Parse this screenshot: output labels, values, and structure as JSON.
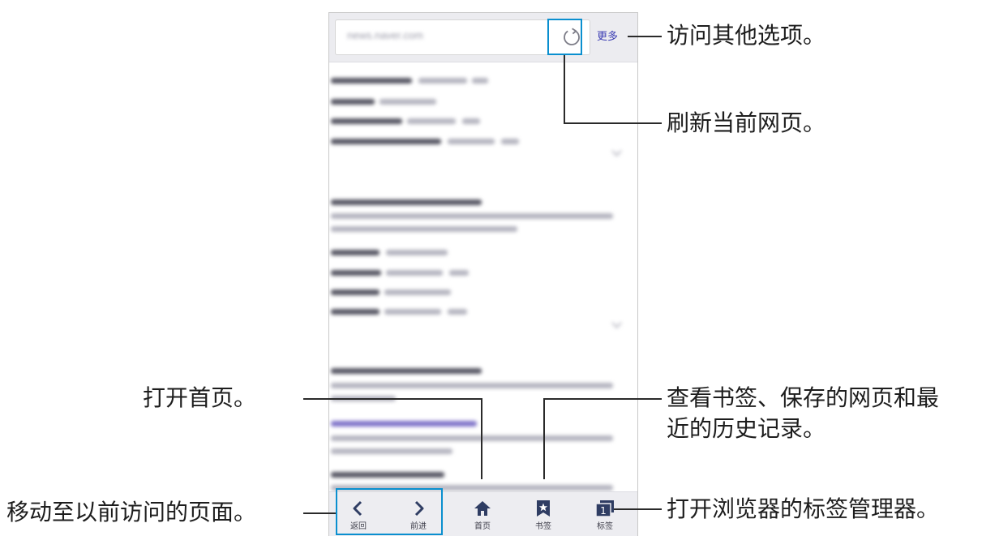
{
  "browser": {
    "url": "news.naver.com",
    "more_label": "更多"
  },
  "nav": {
    "back_label": "返回",
    "forward_label": "前进",
    "home_label": "首页",
    "bookmarks_label": "书签",
    "tabs_label": "标签",
    "tab_count": "1"
  },
  "callouts": {
    "more": "访问其他选项。",
    "refresh": "刷新当前网页。",
    "home": "打开首页。",
    "bookmarks_line1": "查看书签、保存的网页和最",
    "bookmarks_line2": "近的历史记录。",
    "back_forward": "移动至以前访问的页面。",
    "tabs": "打开浏览器的标签管理器。"
  },
  "colors": {
    "highlight": "#0a8fcf",
    "link_text": "#3b3db3",
    "nav_icon": "#2f3d63"
  }
}
